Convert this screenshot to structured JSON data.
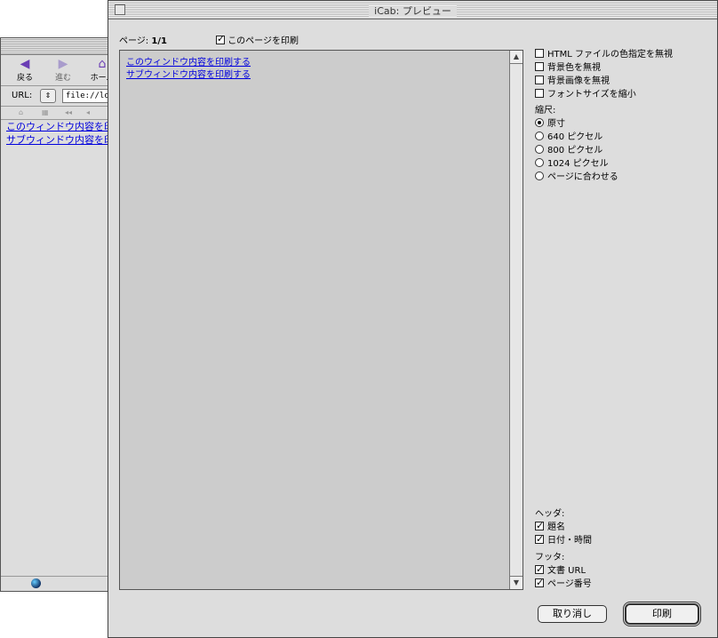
{
  "background_window": {
    "toolbar": [
      {
        "label": "戻る",
        "icon": "back-arrow-icon"
      },
      {
        "label": "進む",
        "icon": "forward-arrow-icon"
      },
      {
        "label": "ホーム",
        "icon": "home-icon"
      }
    ],
    "url_label": "URL:",
    "url_value": "file://loca",
    "links": [
      "このウィンドウ内容を印刷する",
      "サブウィンドウ内容を印刷する"
    ]
  },
  "dialog": {
    "title": "iCab: プレビュー",
    "page_label": "ページ:",
    "page_value": "1/1",
    "print_this_page": {
      "label": "このページを印刷",
      "checked": true
    },
    "preview_links": [
      "このウィンドウ内容を印刷する",
      "サブウィンドウ内容を印刷する"
    ],
    "options": [
      {
        "label": "HTML ファイルの色指定を無視",
        "checked": false
      },
      {
        "label": "背景色を無視",
        "checked": false
      },
      {
        "label": "背景画像を無視",
        "checked": false
      },
      {
        "label": "フォントサイズを縮小",
        "checked": false
      }
    ],
    "scale": {
      "heading": "縮尺:",
      "choices": [
        "原寸",
        "640 ピクセル",
        "800 ピクセル",
        "1024 ピクセル",
        "ページに合わせる"
      ],
      "selected": "原寸"
    },
    "header": {
      "heading": "ヘッダ:",
      "items": [
        {
          "label": "題名",
          "checked": true
        },
        {
          "label": "日付・時間",
          "checked": true
        }
      ]
    },
    "footer": {
      "heading": "フッタ:",
      "items": [
        {
          "label": "文書 URL",
          "checked": true
        },
        {
          "label": "ページ番号",
          "checked": true
        }
      ]
    },
    "buttons": {
      "cancel": "取り消し",
      "print": "印刷"
    }
  }
}
